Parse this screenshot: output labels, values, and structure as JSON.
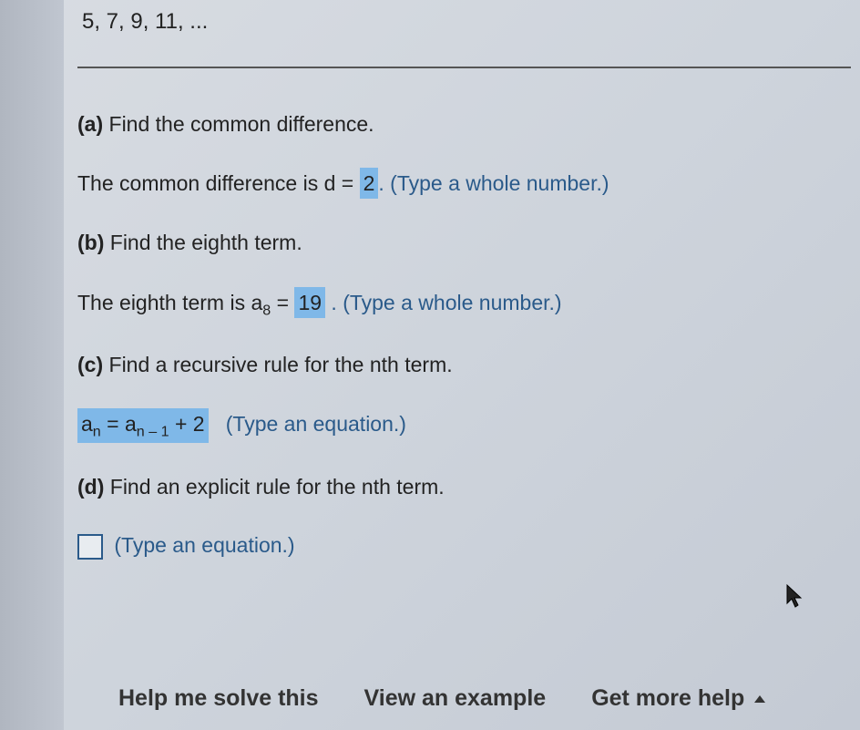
{
  "sequence": "5, 7, 9, 11, ...",
  "parts": {
    "a": {
      "label": "(a)",
      "prompt": "Find the common difference.",
      "answer_prefix": "The common difference is d = ",
      "answer_value": "2",
      "hint": ". (Type a whole number.)"
    },
    "b": {
      "label": "(b)",
      "prompt": "Find the eighth term.",
      "answer_prefix_1": "The eighth term is a",
      "answer_sub": "8",
      "answer_prefix_2": " = ",
      "answer_value": "19",
      "hint": " . (Type a whole number.)"
    },
    "c": {
      "label": "(c)",
      "prompt": "Find a recursive rule for the nth term.",
      "answer_lhs": "a",
      "answer_lhs_sub": "n",
      "answer_eq": " = a",
      "answer_rhs_sub": "n – 1",
      "answer_tail": " + 2",
      "hint": "(Type an equation.)"
    },
    "d": {
      "label": "(d)",
      "prompt": "Find an explicit rule for the nth term.",
      "hint": "(Type an equation.)"
    }
  },
  "bottom": {
    "help": "Help me solve this",
    "example": "View an example",
    "more": "Get more help"
  }
}
